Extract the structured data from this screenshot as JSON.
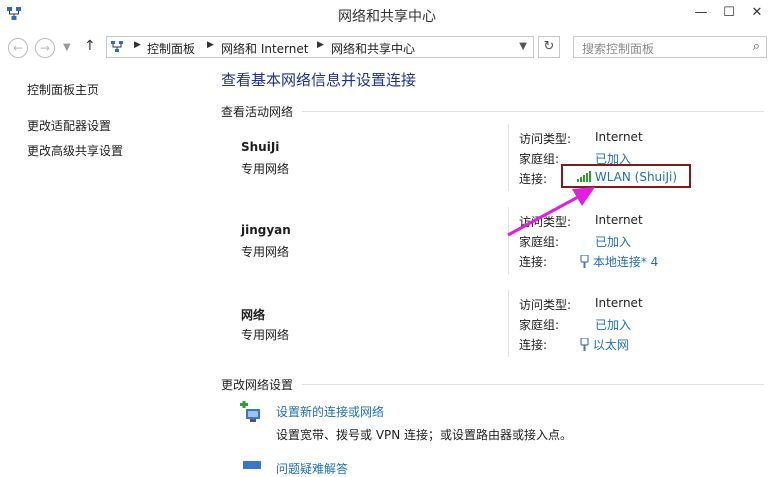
{
  "window": {
    "title": "网络和共享中心"
  },
  "address": {
    "crumbs": [
      "控制面板",
      "网络和 Internet",
      "网络和共享中心"
    ]
  },
  "search": {
    "placeholder": "搜索控制面板"
  },
  "sidebar": {
    "items": [
      {
        "label": "控制面板主页"
      },
      {
        "label": "更改适配器设置"
      },
      {
        "label": "更改高级共享设置"
      }
    ]
  },
  "main": {
    "title": "查看基本网络信息并设置连接",
    "active_section": "查看活动网络",
    "change_section": "更改网络设置",
    "labels": {
      "access": "访问类型:",
      "homegroup": "家庭组:",
      "connection": "连接:"
    },
    "networks": [
      {
        "name": "ShuiJi",
        "type": "专用网络",
        "access": "Internet",
        "homegroup": "已加入",
        "connection": "WLAN (ShuiJi)",
        "conn_icon": "wifi-signal-icon"
      },
      {
        "name": "jingyan",
        "type": "专用网络",
        "access": "Internet",
        "homegroup": "已加入",
        "connection": "本地连接* 4",
        "conn_icon": "ethernet-icon"
      },
      {
        "name": "网络",
        "type": "专用网络",
        "access": "Internet",
        "homegroup": "已加入",
        "connection": "以太网",
        "conn_icon": "ethernet-icon"
      }
    ],
    "tasks": [
      {
        "title": "设置新的连接或网络",
        "desc": "设置宽带、拨号或 VPN 连接；或设置路由器或接入点。"
      },
      {
        "title": "问题疑难解答"
      }
    ]
  },
  "annotation": {
    "highlight_color": "#7d1c1c",
    "arrow_color": "#e020e0"
  }
}
